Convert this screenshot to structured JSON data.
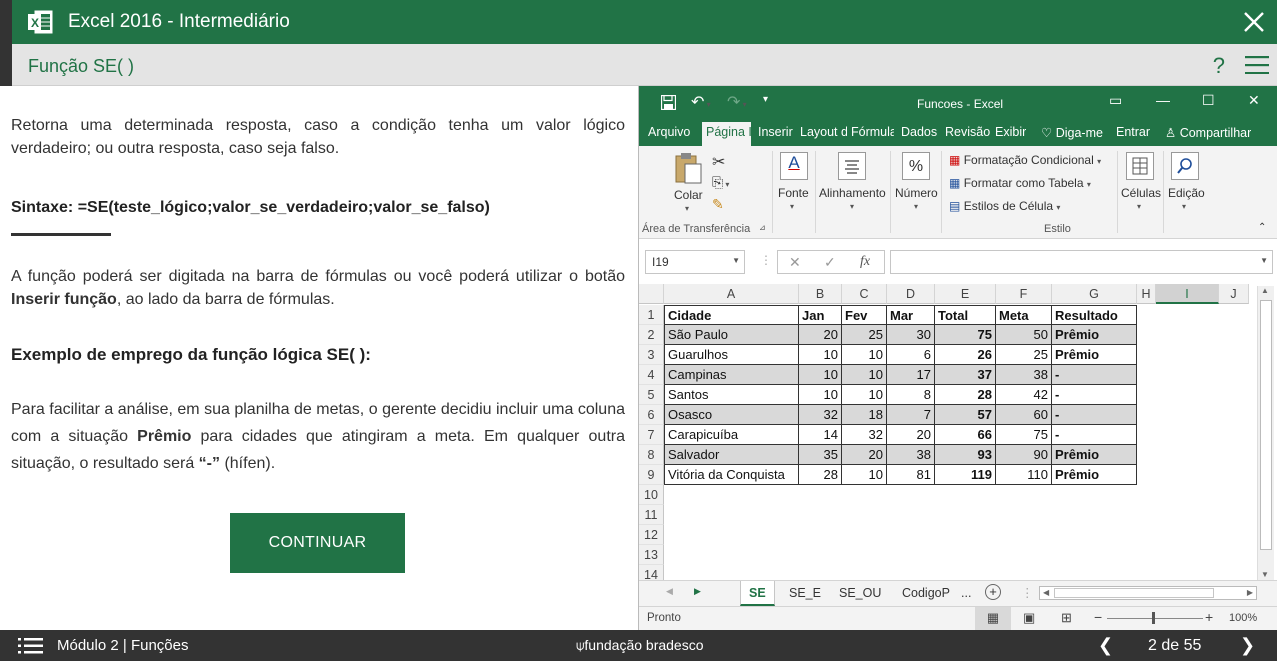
{
  "app": {
    "title": "Excel 2016 - Intermediário"
  },
  "lesson": {
    "title": "Função SE( )"
  },
  "content": {
    "intro": "Retorna uma determinada resposta, caso a condição tenha um valor lógico verdadeiro; ou outra resposta, caso seja falso.",
    "syntax": "Sintaxe: =SE(teste_lógico;valor_se_verdadeiro;valor_se_falso)",
    "p2_start": "A função poderá ser digitada na barra de fórmulas ou você poderá utilizar o botão ",
    "p2_bold": "Inserir função",
    "p2_end": ", ao lado da barra de fórmulas.",
    "example_heading": "Exemplo de emprego da função lógica SE( ):",
    "p3_start": "Para facilitar a análise, em sua planilha de metas, o gerente decidiu incluir uma coluna com a situação ",
    "p3_bold": "Prêmio",
    "p3_mid": " para cidades que atingiram a meta. Em qualquer outra situação, o resultado será ",
    "p3_bold2": "“-”",
    "p3_end": " (hífen).",
    "continue_label": "CONTINUAR"
  },
  "excel": {
    "doc_title": "Funcoes - Excel",
    "tabs": [
      "Arquivo",
      "Página I",
      "Inserir",
      "Layout d",
      "Fórmula",
      "Dados",
      "Revisão",
      "Exibir",
      "Diga-me",
      "Entrar",
      "Compartilhar"
    ],
    "ribbon": {
      "colar": "Colar",
      "clipboard_group": "Área de Transferência",
      "fonte": "Fonte",
      "alinhamento": "Alinhamento",
      "numero": "Número",
      "number_symbol": "%",
      "font_letter": "A",
      "formatacao_condicional": "Formatação Condicional",
      "formatar_tabela": "Formatar como Tabela",
      "estilos_celula": "Estilos de Célula",
      "estilo_group": "Estilo",
      "celulas": "Células",
      "edicao": "Edição"
    },
    "name_box": "I19",
    "fx_label": "fx",
    "columns": [
      "A",
      "B",
      "C",
      "D",
      "E",
      "F",
      "G",
      "H",
      "I",
      "J"
    ],
    "rows": [
      "1",
      "2",
      "3",
      "4",
      "5",
      "6",
      "7",
      "8",
      "9",
      "10",
      "11",
      "12",
      "13",
      "14"
    ],
    "table": {
      "headers": [
        "Cidade",
        "Jan",
        "Fev",
        "Mar",
        "Total",
        "Meta",
        "Resultado"
      ],
      "rows": [
        [
          "São Paulo",
          "20",
          "25",
          "30",
          "75",
          "50",
          "Prêmio"
        ],
        [
          "Guarulhos",
          "10",
          "10",
          "6",
          "26",
          "25",
          "Prêmio"
        ],
        [
          "Campinas",
          "10",
          "10",
          "17",
          "37",
          "38",
          "-"
        ],
        [
          "Santos",
          "10",
          "10",
          "8",
          "28",
          "42",
          "-"
        ],
        [
          "Osasco",
          "32",
          "18",
          "7",
          "57",
          "60",
          "-"
        ],
        [
          "Carapicuíba",
          "14",
          "32",
          "20",
          "66",
          "75",
          "-"
        ],
        [
          "Salvador",
          "35",
          "20",
          "38",
          "93",
          "90",
          "Prêmio"
        ],
        [
          "Vitória da Conquista",
          "28",
          "10",
          "81",
          "119",
          "110",
          "Prêmio"
        ]
      ]
    },
    "sheet_tabs": [
      "SE",
      "SE_E",
      "SE_OU",
      "CodigoP",
      "..."
    ],
    "status": "Pronto",
    "zoom": "100%"
  },
  "footer": {
    "module": "Módulo 2 | Funções",
    "brand": "fundação bradesco",
    "page": "2 de 55"
  },
  "colors": {
    "brand_green": "#217346",
    "dark": "#333333"
  }
}
